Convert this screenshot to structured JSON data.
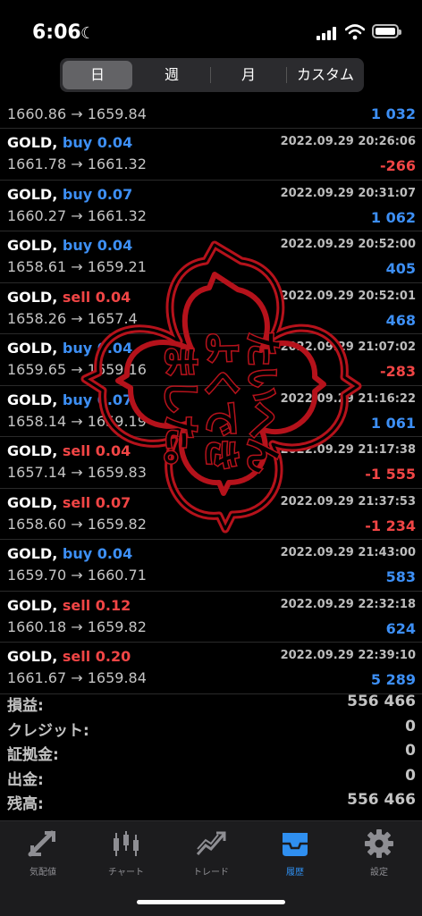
{
  "status": {
    "time": "6:06"
  },
  "segment": {
    "options": [
      "日",
      "週",
      "月",
      "カスタム"
    ],
    "selected": 0
  },
  "first_row": {
    "prices": "1660.86 → 1659.84",
    "profit": "1 032"
  },
  "trades": [
    {
      "symbol": "GOLD,",
      "side": "buy 0.04",
      "type": "buy",
      "date": "2022.09.29 20:26:06",
      "prices": "1661.78 → 1661.32",
      "profit": "-266"
    },
    {
      "symbol": "GOLD,",
      "side": "buy 0.07",
      "type": "buy",
      "date": "2022.09.29 20:31:07",
      "prices": "1660.27 → 1661.32",
      "profit": "1 062"
    },
    {
      "symbol": "GOLD,",
      "side": "buy 0.04",
      "type": "buy",
      "date": "2022.09.29 20:52:00",
      "prices": "1658.61 → 1659.21",
      "profit": "405"
    },
    {
      "symbol": "GOLD,",
      "side": "sell 0.04",
      "type": "sell",
      "date": "2022.09.29 20:52:01",
      "prices": "1658.26 → 1657.4",
      "profit": "468"
    },
    {
      "symbol": "GOLD,",
      "side": "buy 0.04",
      "type": "buy",
      "date": "2022.09.29 21:07:02",
      "prices": "1659.65 → 1659.16",
      "profit": "-283"
    },
    {
      "symbol": "GOLD,",
      "side": "buy 0.07",
      "type": "buy",
      "date": "2022.09.29 21:16:22",
      "prices": "1658.14 → 1659.19",
      "profit": "1 061"
    },
    {
      "symbol": "GOLD,",
      "side": "sell 0.04",
      "type": "sell",
      "date": "2022.09.29 21:17:38",
      "prices": "1657.14 → 1659.83",
      "profit": "-1 555"
    },
    {
      "symbol": "GOLD,",
      "side": "sell 0.07",
      "type": "sell",
      "date": "2022.09.29 21:37:53",
      "prices": "1658.60 → 1659.82",
      "profit": "-1 234"
    },
    {
      "symbol": "GOLD,",
      "side": "buy 0.04",
      "type": "buy",
      "date": "2022.09.29 21:43:00",
      "prices": "1659.70 → 1660.71",
      "profit": "583"
    },
    {
      "symbol": "GOLD,",
      "side": "sell 0.12",
      "type": "sell",
      "date": "2022.09.29 22:32:18",
      "prices": "1660.18 → 1659.82",
      "profit": "624"
    },
    {
      "symbol": "GOLD,",
      "side": "sell 0.20",
      "type": "sell",
      "date": "2022.09.29 22:39:10",
      "prices": "1661.67 → 1659.84",
      "profit": "5 289"
    }
  ],
  "summary": [
    {
      "label": "損益:",
      "value": "556 466"
    },
    {
      "label": "クレジット:",
      "value": "0"
    },
    {
      "label": "証拠金:",
      "value": "0"
    },
    {
      "label": "出金:",
      "value": "0"
    },
    {
      "label": "残高:",
      "value": "556 466"
    }
  ],
  "stamp": {
    "text_lines": [
      "たいへん",
      "よくでき",
      "ました。"
    ],
    "color": "#b5121b"
  },
  "tabs": [
    {
      "label": "気配値",
      "icon": "quotes-icon"
    },
    {
      "label": "チャート",
      "icon": "chart-icon"
    },
    {
      "label": "トレード",
      "icon": "trade-icon"
    },
    {
      "label": "履歴",
      "icon": "history-icon",
      "active": true
    },
    {
      "label": "設定",
      "icon": "settings-icon"
    }
  ],
  "colors": {
    "buy": "#3d8ff5",
    "sell": "#f04545",
    "active_tab": "#2f8ff0"
  }
}
